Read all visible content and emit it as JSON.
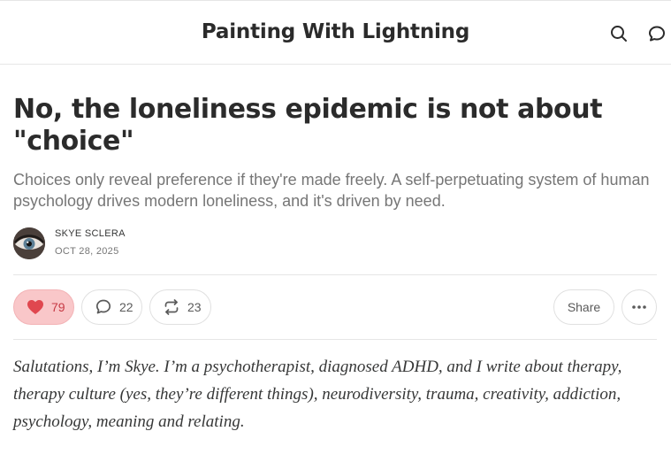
{
  "header": {
    "publication_title": "Painting With Lightning",
    "search_icon": "search-icon",
    "chat_icon": "chat-bubble-icon"
  },
  "post": {
    "title": "No, the loneliness epidemic is not about \"choice\"",
    "subtitle": "Choices only reveal preference if they're made freely. A self-perpetuating system of human psychology drives modern loneliness, and it's driven by need.",
    "author": "SKYE SCLERA",
    "date": "OCT 28, 2025"
  },
  "actions": {
    "likes": "79",
    "comments": "22",
    "restacks": "23",
    "share_label": "Share",
    "like_color": "#e0474f"
  },
  "body": {
    "intro": "Salutations, I’m Skye. I’m a psychotherapist, diagnosed ADHD, and I write about therapy, therapy culture (yes, they’re different things), neurodiversity, trauma, creativity, addiction, psychology, meaning and relating."
  }
}
